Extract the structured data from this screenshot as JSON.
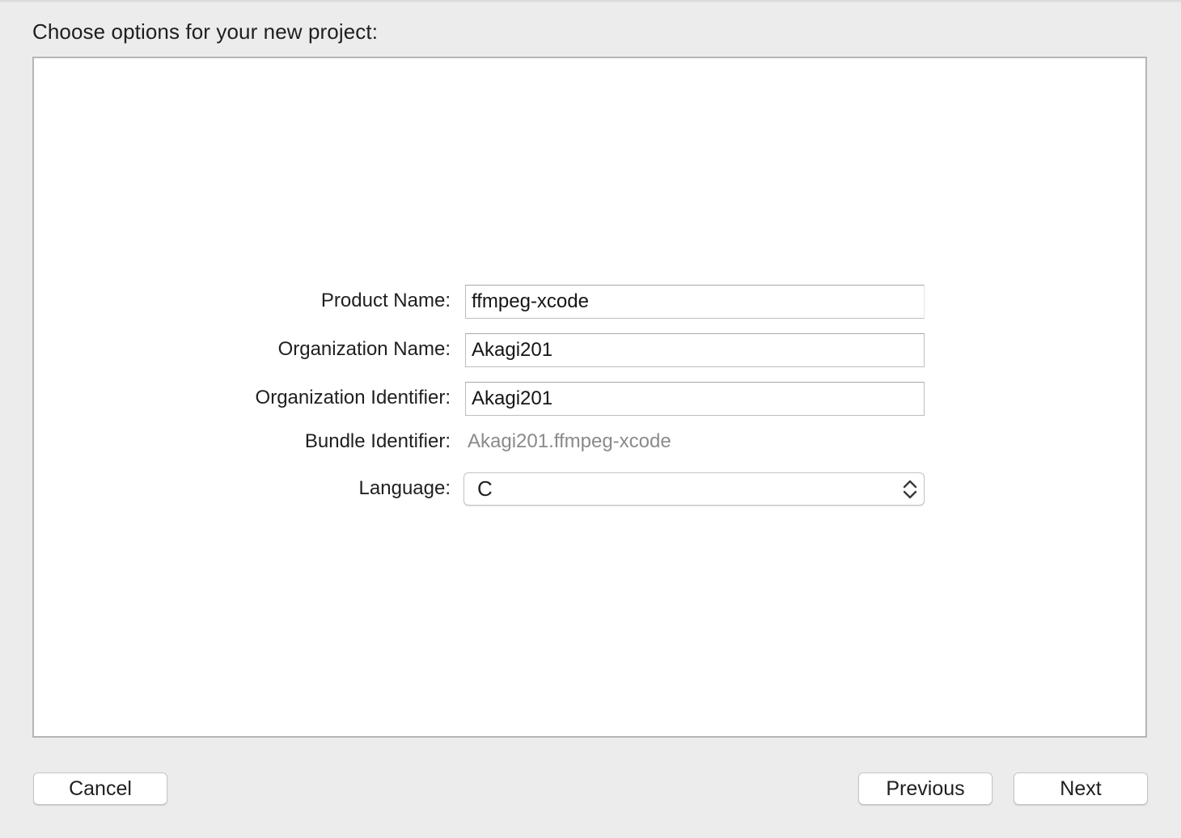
{
  "header": {
    "title": "Choose options for your new project:"
  },
  "form": {
    "product_name": {
      "label": "Product Name:",
      "value": "ffmpeg-xcode"
    },
    "organization_name": {
      "label": "Organization Name:",
      "value": "Akagi201"
    },
    "organization_identifier": {
      "label": "Organization Identifier:",
      "value": "Akagi201"
    },
    "bundle_identifier": {
      "label": "Bundle Identifier:",
      "value": "Akagi201.ffmpeg-xcode"
    },
    "language": {
      "label": "Language:",
      "selected": "C",
      "icon": "up-down-chevron-icon"
    }
  },
  "footer": {
    "cancel_label": "Cancel",
    "previous_label": "Previous",
    "next_label": "Next"
  },
  "colors": {
    "window_background": "#ececec",
    "panel_background": "#ffffff",
    "panel_border": "#b5b5b5",
    "secondary_text": "#8a8a8a"
  }
}
